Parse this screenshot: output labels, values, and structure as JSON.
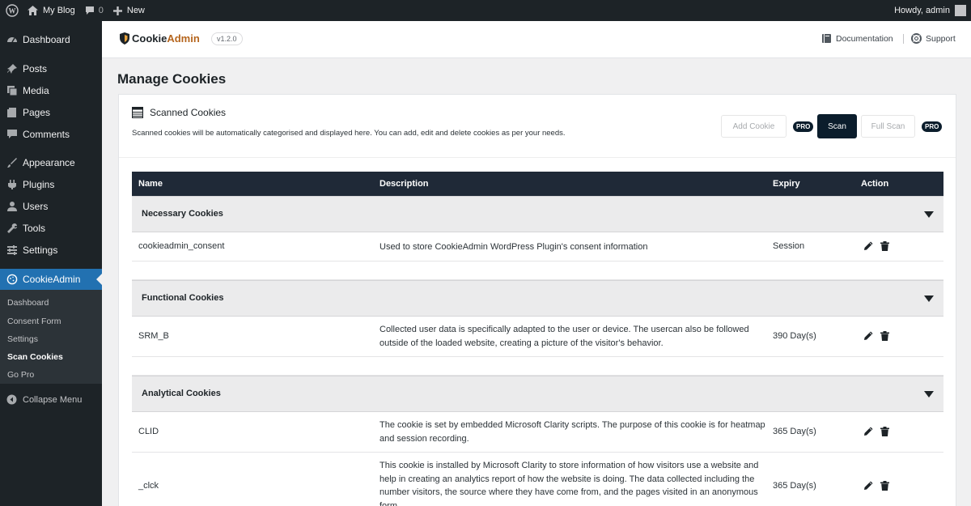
{
  "adminbar": {
    "site_name": "My Blog",
    "comments_count": "0",
    "new_label": "New",
    "howdy": "Howdy, admin"
  },
  "sidebar": {
    "items": [
      {
        "label": "Dashboard",
        "icon": "dashboard-icon"
      },
      {
        "label": "Posts",
        "icon": "pin-icon"
      },
      {
        "label": "Media",
        "icon": "media-icon"
      },
      {
        "label": "Pages",
        "icon": "pages-icon"
      },
      {
        "label": "Comments",
        "icon": "comment-icon"
      },
      {
        "label": "Appearance",
        "icon": "brush-icon"
      },
      {
        "label": "Plugins",
        "icon": "plug-icon"
      },
      {
        "label": "Users",
        "icon": "user-icon"
      },
      {
        "label": "Tools",
        "icon": "wrench-icon"
      },
      {
        "label": "Settings",
        "icon": "settings-icon"
      },
      {
        "label": "CookieAdmin",
        "icon": "cookie-icon"
      }
    ],
    "submenu": [
      "Dashboard",
      "Consent Form",
      "Settings",
      "Scan Cookies",
      "Go Pro"
    ],
    "collapse_label": "Collapse Menu"
  },
  "plugin_header": {
    "logo_part1": "Cookie",
    "logo_part2": "Admin",
    "version": "v1.2.0",
    "documentation": "Documentation",
    "support": "Support"
  },
  "page_title": "Manage Cookies",
  "card": {
    "title": "Scanned Cookies",
    "description": "Scanned cookies will be automatically categorised and displayed here. You can add, edit and delete cookies as per your needs.",
    "add_cookie": "Add Cookie",
    "scan": "Scan",
    "full_scan": "Full Scan",
    "pro_badge": "PRO"
  },
  "table": {
    "headers": {
      "name": "Name",
      "description": "Description",
      "expiry": "Expiry",
      "action": "Action"
    },
    "groups": [
      {
        "label": "Necessary Cookies",
        "rows": [
          {
            "name": "cookieadmin_consent",
            "description": "Used to store CookieAdmin WordPress Plugin's consent information",
            "expiry": "Session"
          }
        ]
      },
      {
        "label": "Functional Cookies",
        "rows": [
          {
            "name": "SRM_B",
            "description": "Collected user data is specifically adapted to the user or device. The usercan also be followed outside of the loaded website, creating a picture of the visitor's behavior.",
            "expiry": "390 Day(s)"
          }
        ]
      },
      {
        "label": "Analytical Cookies",
        "rows": [
          {
            "name": "CLID",
            "description": "The cookie is set by embedded Microsoft Clarity scripts. The purpose of this cookie is for heatmap and session recording.",
            "expiry": "365 Day(s)"
          },
          {
            "name": "_clck",
            "description": "This cookie is installed by Microsoft Clarity to store information of how visitors use a website and help in creating an analytics report of how the website is doing. The data collected including the number visitors, the source where they have come from, and the pages visited in an anonymous form.",
            "expiry": "365 Day(s)"
          }
        ]
      }
    ]
  }
}
